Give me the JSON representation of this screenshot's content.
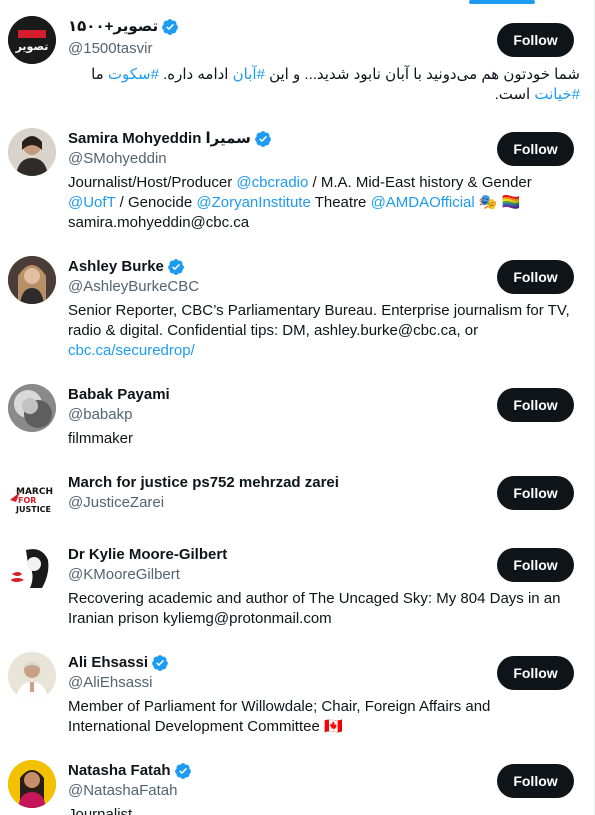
{
  "accounts": [
    {
      "name": "۱۵۰۰+تصویر",
      "handle": "@1500tasvir",
      "verified": true,
      "bio_rtl": true,
      "bio_parts": [
        {
          "text": "شما خودتون هم می‌دونید با آبان نابود شدید... و این ",
          "link": false
        },
        {
          "text": "#آبان",
          "link": true
        },
        {
          "text": " ادامه داره. ",
          "link": false
        },
        {
          "text": "#سکوت",
          "link": true
        },
        {
          "text": " ما ",
          "link": false
        },
        {
          "text": "#خیانت",
          "link": true
        },
        {
          "text": " است.",
          "link": false
        }
      ],
      "follow_label": "Follow",
      "avatar_icon": "1500tasvir-logo-icon"
    },
    {
      "name": "Samira Mohyeddin سمیرا",
      "handle": "@SMohyeddin",
      "verified": true,
      "bio_parts": [
        {
          "text": "Journalist/Host/Producer ",
          "link": false
        },
        {
          "text": "@cbcradio",
          "link": true
        },
        {
          "text": " / M.A. Mid-East history & Gender ",
          "link": false
        },
        {
          "text": "@UofT",
          "link": true
        },
        {
          "text": " / Genocide ",
          "link": false
        },
        {
          "text": "@ZoryanInstitute",
          "link": true
        },
        {
          "text": " Theatre ",
          "link": false
        },
        {
          "text": "@AMDAOfficial",
          "link": true
        },
        {
          "text": " 🎭 🏳️‍🌈 samira.mohyeddin@cbc.ca",
          "link": false
        }
      ],
      "follow_label": "Follow",
      "avatar_icon": "user-photo-icon"
    },
    {
      "name": "Ashley Burke",
      "handle": "@AshleyBurkeCBC",
      "verified": true,
      "bio_parts": [
        {
          "text": "Senior Reporter, CBC’s Parliamentary Bureau. Enterprise journalism for TV, radio & digital. Confidential tips: DM, ashley.burke@cbc.ca, or ",
          "link": false
        },
        {
          "text": "cbc.ca/securedrop/",
          "link": true
        }
      ],
      "follow_label": "Follow",
      "avatar_icon": "user-photo-icon"
    },
    {
      "name": "Babak Payami",
      "handle": "@babakp",
      "verified": false,
      "bio_parts": [
        {
          "text": "filmmaker",
          "link": false
        }
      ],
      "follow_label": "Follow",
      "avatar_icon": "user-photo-icon"
    },
    {
      "name": "March for justice ps752 mehrzad zarei",
      "handle": "@JusticeZarei",
      "verified": false,
      "bio_parts": [],
      "follow_label": "Follow",
      "avatar_icon": "march-for-justice-logo-icon",
      "avatar_text": [
        "MARCH",
        "FOR",
        "JUSTICE"
      ]
    },
    {
      "name": "Dr Kylie Moore-Gilbert",
      "handle": "@KMooreGilbert",
      "verified": false,
      "bio_parts": [
        {
          "text": "Recovering academic and author of The Uncaged Sky: My 804 Days in an Iranian prison kyliemg@protonmail.com",
          "link": false
        }
      ],
      "follow_label": "Follow",
      "avatar_icon": "user-illustration-icon"
    },
    {
      "name": "Ali Ehsassi",
      "handle": "@AliEhsassi",
      "verified": true,
      "bio_parts": [
        {
          "text": "Member of Parliament for Willowdale; Chair, Foreign Affairs and International Development Committee 🇨🇦",
          "link": false
        }
      ],
      "follow_label": "Follow",
      "avatar_icon": "user-photo-icon"
    },
    {
      "name": "Natasha Fatah",
      "handle": "@NatashaFatah",
      "verified": true,
      "bio_parts": [
        {
          "text": "Journalist",
          "link": false
        }
      ],
      "follow_label": "Follow",
      "avatar_icon": "user-photo-icon"
    }
  ],
  "colors": {
    "accent": "#1d9bf0",
    "text": "#0f1419",
    "muted": "#536471",
    "button_bg": "#0f1419",
    "button_text": "#ffffff"
  }
}
